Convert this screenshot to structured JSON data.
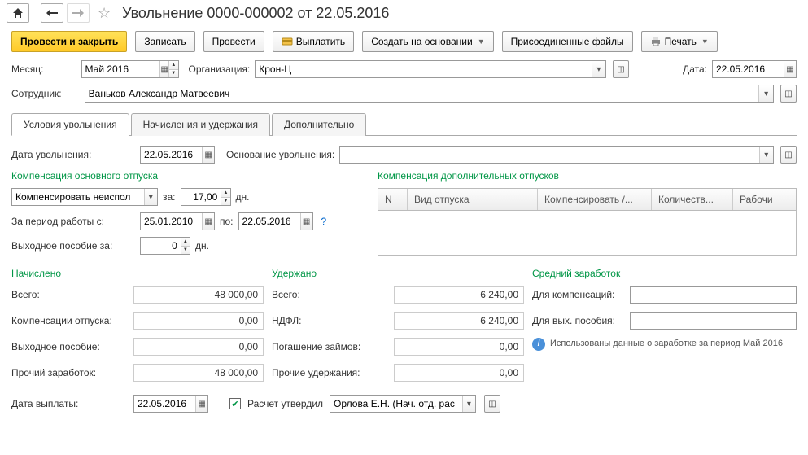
{
  "title": "Увольнение 0000-000002 от 22.05.2016",
  "toolbar": {
    "post_close": "Провести и закрыть",
    "save": "Записать",
    "post": "Провести",
    "pay": "Выплатить",
    "create_based": "Создать на основании",
    "attached": "Присоединенные файлы",
    "print": "Печать"
  },
  "form": {
    "month_label": "Месяц:",
    "month_value": "Май 2016",
    "org_label": "Организация:",
    "org_value": "Крон-Ц",
    "date_label": "Дата:",
    "date_value": "22.05.2016",
    "employee_label": "Сотрудник:",
    "employee_value": "Ваньков Александр Матвеевич"
  },
  "tabs": {
    "t1": "Условия увольнения",
    "t2": "Начисления и удержания",
    "t3": "Дополнительно"
  },
  "dismissal": {
    "date_label": "Дата увольнения:",
    "date_value": "22.05.2016",
    "reason_label": "Основание увольнения:",
    "reason_value": "",
    "comp_main_title": "Компенсация основного отпуска",
    "comp_mode": "Компенсировать неиспол",
    "for_label": "за:",
    "days_value": "17,00",
    "days_unit": "дн.",
    "period_label": "За период работы с:",
    "period_from": "25.01.2010",
    "period_to_label": "по:",
    "period_to": "22.05.2016",
    "severance_label": "Выходное пособие за:",
    "severance_value": "0",
    "comp_extra_title": "Компенсация дополнительных отпусков",
    "table": {
      "c1": "N",
      "c2": "Вид отпуска",
      "c3": "Компенсировать /...",
      "c4": "Количеств...",
      "c5": "Рабочи"
    }
  },
  "summary": {
    "accrued_title": "Начислено",
    "withheld_title": "Удержано",
    "avg_title": "Средний заработок",
    "total_label": "Всего:",
    "total_accrued": "48 000,00",
    "total_withheld": "6 240,00",
    "comp_vac_label": "Компенсации отпуска:",
    "comp_vac_value": "0,00",
    "ndfl_label": "НДФЛ:",
    "ndfl_value": "6 240,00",
    "severance_label": "Выходное пособие:",
    "severance_value": "0,00",
    "loans_label": "Погашение займов:",
    "loans_value": "0,00",
    "other_earn_label": "Прочий заработок:",
    "other_earn_value": "48 000,00",
    "other_ded_label": "Прочие удержания:",
    "other_ded_value": "0,00",
    "for_comp_label": "Для компенсаций:",
    "for_sev_label": "Для вых. пособия:",
    "info_text": "Использованы данные о заработке за период Май 2016"
  },
  "footer": {
    "paydate_label": "Дата выплаты:",
    "paydate_value": "22.05.2016",
    "approved_label": "Расчет утвердил",
    "approver": "Орлова Е.Н. (Нач. отд. рас"
  }
}
